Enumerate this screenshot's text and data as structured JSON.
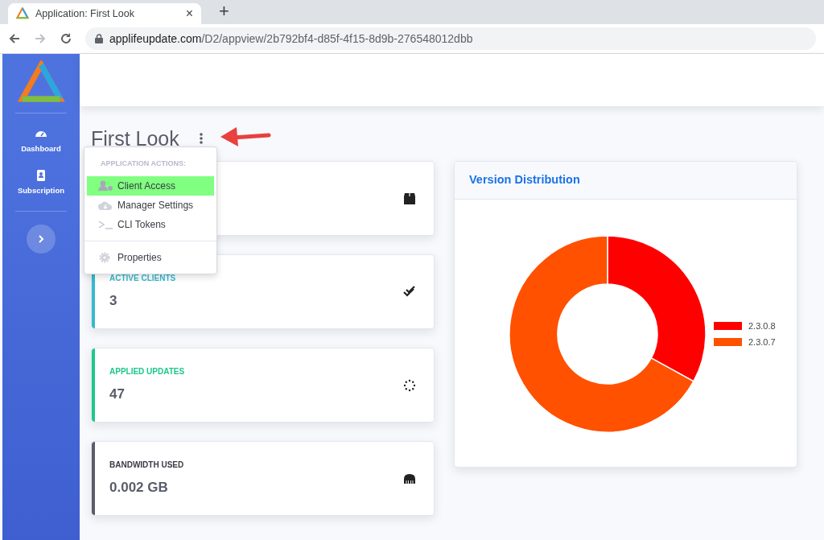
{
  "browser": {
    "tab": {
      "title": "Application: First Look",
      "close": "×"
    },
    "new_tab": "+",
    "url_host": "applifeupdate.com",
    "url_path": "/D2/appview/2b792bf4-d85f-4f15-8d9b-276548012dbb",
    "forward_disabled": true
  },
  "sidebar": {
    "items": [
      {
        "label": "Dashboard",
        "kind": "gauge"
      },
      {
        "label": "Subscription",
        "kind": "contact"
      }
    ]
  },
  "page": {
    "title": "First Look"
  },
  "menu": {
    "header": "APPLICATION ACTIONS:",
    "items": [
      {
        "label": "Client Access",
        "kind": "user",
        "selected": true
      },
      {
        "label": "Manager Settings",
        "kind": "cloud",
        "selected": false
      },
      {
        "label": "CLI Tokens",
        "kind": "terminal",
        "selected": false
      },
      {
        "label": "Properties",
        "kind": "gear",
        "selected": false
      }
    ]
  },
  "stats": [
    {
      "kind": "box"
    },
    {
      "kind": "checks",
      "label": "ACTIVE CLIENTS",
      "value": "3",
      "color": "#36b9cc"
    },
    {
      "kind": "spinner",
      "label": "APPLIED UPDATES",
      "value": "47",
      "color": "#1cc88a"
    },
    {
      "kind": "network",
      "label": "BANDWIDTH USED",
      "value": "0.002 GB",
      "color": "#5a5c69"
    }
  ],
  "chart": {
    "title": "Version Distribution",
    "legend": [
      {
        "name": "2.3.0.8",
        "color": "#ff0000"
      },
      {
        "name": "2.3.0.7",
        "color": "#ff5100"
      }
    ]
  }
}
